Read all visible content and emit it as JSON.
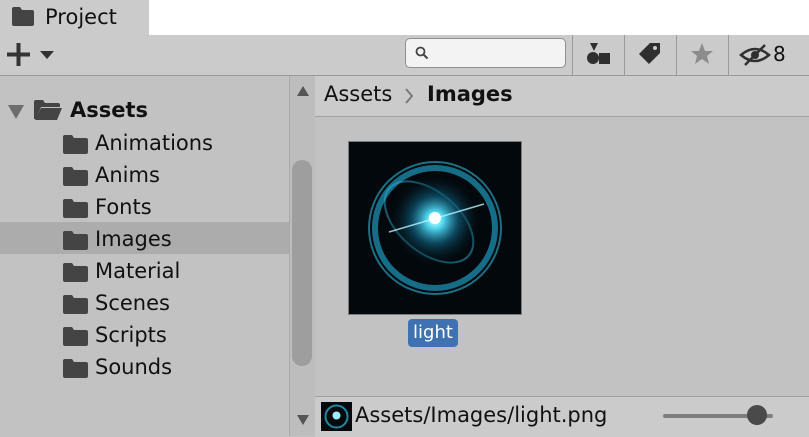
{
  "window": {
    "tab_label": "Project"
  },
  "toolbar": {
    "search_placeholder": "",
    "hidden_count": "8"
  },
  "tree": {
    "root_label": "Assets",
    "items": [
      {
        "label": "Animations"
      },
      {
        "label": "Anims"
      },
      {
        "label": "Fonts"
      },
      {
        "label": "Images",
        "selected": true
      },
      {
        "label": "Material"
      },
      {
        "label": "Scenes"
      },
      {
        "label": "Scripts"
      },
      {
        "label": "Sounds"
      }
    ]
  },
  "breadcrumb": {
    "root": "Assets",
    "current": "Images"
  },
  "assets": [
    {
      "name": "light"
    }
  ],
  "status": {
    "path": "Assets/Images/light.png",
    "zoom_fraction": 0.85
  },
  "colors": {
    "selection": "#3f72b3",
    "selected_row": "#acacac",
    "background": "#c2c2c2"
  }
}
